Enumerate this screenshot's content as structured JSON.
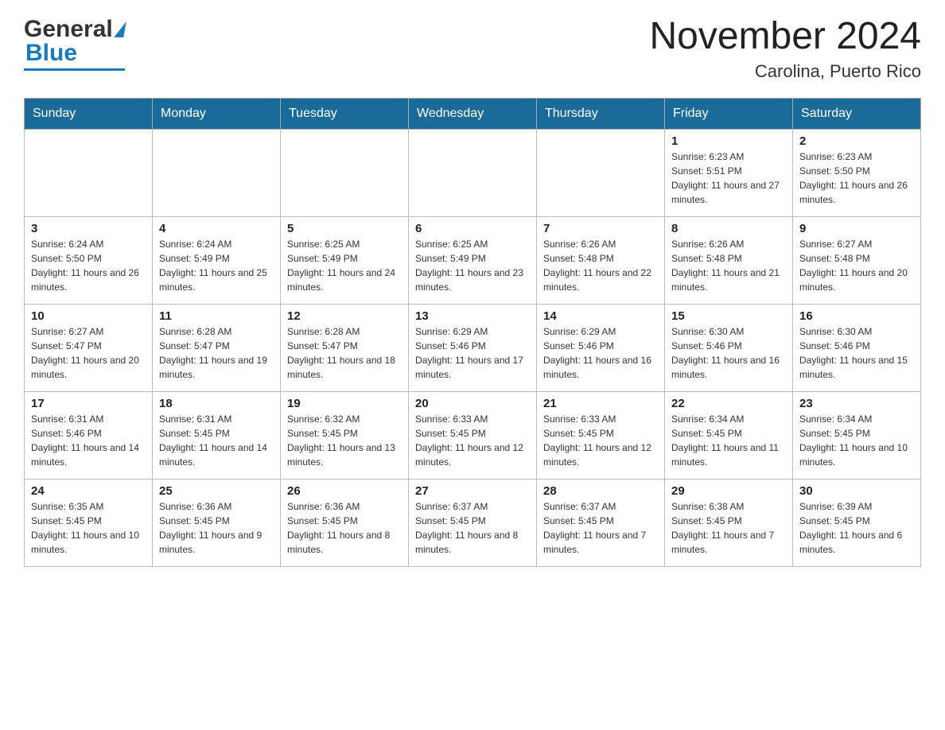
{
  "header": {
    "logo_general": "General",
    "logo_blue": "Blue",
    "month_title": "November 2024",
    "location": "Carolina, Puerto Rico"
  },
  "days_of_week": [
    "Sunday",
    "Monday",
    "Tuesday",
    "Wednesday",
    "Thursday",
    "Friday",
    "Saturday"
  ],
  "rows": [
    [
      {
        "day": "",
        "info": ""
      },
      {
        "day": "",
        "info": ""
      },
      {
        "day": "",
        "info": ""
      },
      {
        "day": "",
        "info": ""
      },
      {
        "day": "",
        "info": ""
      },
      {
        "day": "1",
        "info": "Sunrise: 6:23 AM\nSunset: 5:51 PM\nDaylight: 11 hours and 27 minutes."
      },
      {
        "day": "2",
        "info": "Sunrise: 6:23 AM\nSunset: 5:50 PM\nDaylight: 11 hours and 26 minutes."
      }
    ],
    [
      {
        "day": "3",
        "info": "Sunrise: 6:24 AM\nSunset: 5:50 PM\nDaylight: 11 hours and 26 minutes."
      },
      {
        "day": "4",
        "info": "Sunrise: 6:24 AM\nSunset: 5:49 PM\nDaylight: 11 hours and 25 minutes."
      },
      {
        "day": "5",
        "info": "Sunrise: 6:25 AM\nSunset: 5:49 PM\nDaylight: 11 hours and 24 minutes."
      },
      {
        "day": "6",
        "info": "Sunrise: 6:25 AM\nSunset: 5:49 PM\nDaylight: 11 hours and 23 minutes."
      },
      {
        "day": "7",
        "info": "Sunrise: 6:26 AM\nSunset: 5:48 PM\nDaylight: 11 hours and 22 minutes."
      },
      {
        "day": "8",
        "info": "Sunrise: 6:26 AM\nSunset: 5:48 PM\nDaylight: 11 hours and 21 minutes."
      },
      {
        "day": "9",
        "info": "Sunrise: 6:27 AM\nSunset: 5:48 PM\nDaylight: 11 hours and 20 minutes."
      }
    ],
    [
      {
        "day": "10",
        "info": "Sunrise: 6:27 AM\nSunset: 5:47 PM\nDaylight: 11 hours and 20 minutes."
      },
      {
        "day": "11",
        "info": "Sunrise: 6:28 AM\nSunset: 5:47 PM\nDaylight: 11 hours and 19 minutes."
      },
      {
        "day": "12",
        "info": "Sunrise: 6:28 AM\nSunset: 5:47 PM\nDaylight: 11 hours and 18 minutes."
      },
      {
        "day": "13",
        "info": "Sunrise: 6:29 AM\nSunset: 5:46 PM\nDaylight: 11 hours and 17 minutes."
      },
      {
        "day": "14",
        "info": "Sunrise: 6:29 AM\nSunset: 5:46 PM\nDaylight: 11 hours and 16 minutes."
      },
      {
        "day": "15",
        "info": "Sunrise: 6:30 AM\nSunset: 5:46 PM\nDaylight: 11 hours and 16 minutes."
      },
      {
        "day": "16",
        "info": "Sunrise: 6:30 AM\nSunset: 5:46 PM\nDaylight: 11 hours and 15 minutes."
      }
    ],
    [
      {
        "day": "17",
        "info": "Sunrise: 6:31 AM\nSunset: 5:46 PM\nDaylight: 11 hours and 14 minutes."
      },
      {
        "day": "18",
        "info": "Sunrise: 6:31 AM\nSunset: 5:45 PM\nDaylight: 11 hours and 14 minutes."
      },
      {
        "day": "19",
        "info": "Sunrise: 6:32 AM\nSunset: 5:45 PM\nDaylight: 11 hours and 13 minutes."
      },
      {
        "day": "20",
        "info": "Sunrise: 6:33 AM\nSunset: 5:45 PM\nDaylight: 11 hours and 12 minutes."
      },
      {
        "day": "21",
        "info": "Sunrise: 6:33 AM\nSunset: 5:45 PM\nDaylight: 11 hours and 12 minutes."
      },
      {
        "day": "22",
        "info": "Sunrise: 6:34 AM\nSunset: 5:45 PM\nDaylight: 11 hours and 11 minutes."
      },
      {
        "day": "23",
        "info": "Sunrise: 6:34 AM\nSunset: 5:45 PM\nDaylight: 11 hours and 10 minutes."
      }
    ],
    [
      {
        "day": "24",
        "info": "Sunrise: 6:35 AM\nSunset: 5:45 PM\nDaylight: 11 hours and 10 minutes."
      },
      {
        "day": "25",
        "info": "Sunrise: 6:36 AM\nSunset: 5:45 PM\nDaylight: 11 hours and 9 minutes."
      },
      {
        "day": "26",
        "info": "Sunrise: 6:36 AM\nSunset: 5:45 PM\nDaylight: 11 hours and 8 minutes."
      },
      {
        "day": "27",
        "info": "Sunrise: 6:37 AM\nSunset: 5:45 PM\nDaylight: 11 hours and 8 minutes."
      },
      {
        "day": "28",
        "info": "Sunrise: 6:37 AM\nSunset: 5:45 PM\nDaylight: 11 hours and 7 minutes."
      },
      {
        "day": "29",
        "info": "Sunrise: 6:38 AM\nSunset: 5:45 PM\nDaylight: 11 hours and 7 minutes."
      },
      {
        "day": "30",
        "info": "Sunrise: 6:39 AM\nSunset: 5:45 PM\nDaylight: 11 hours and 6 minutes."
      }
    ]
  ]
}
